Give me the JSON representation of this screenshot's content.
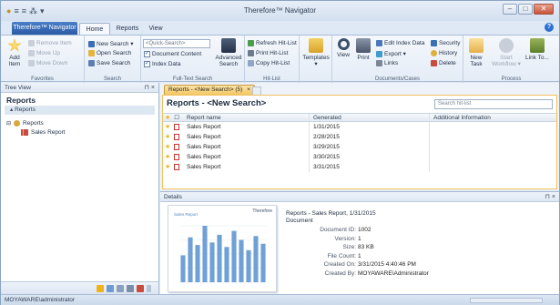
{
  "window": {
    "title": "Therefore™ Navigator",
    "help": "?"
  },
  "qat": [
    "●",
    "≡",
    "≡",
    "⁂",
    "▾"
  ],
  "tabs": {
    "app_menu": "Therefore™ Navigator",
    "home": "Home",
    "reports": "Reports",
    "view": "View"
  },
  "ribbon": {
    "favorites": {
      "add": "Add Item",
      "remove": "Remove Item",
      "move_up": "Move Up",
      "move_down": "Move Down",
      "label": "Favorites"
    },
    "search": {
      "new_search": "New Search ▾",
      "open_search": "Open Search",
      "save_search": "Save Search",
      "label": "Search"
    },
    "fulltext": {
      "placeholder": "<Quick-Search>",
      "document_content": "Document Content",
      "index_data": "Index Data",
      "advanced": "Advanced Search",
      "label": "Full-Text Search"
    },
    "hitlist": {
      "refresh": "Refresh Hit-List",
      "print": "Print Hit-List",
      "copy": "Copy Hit-List",
      "label": "Hit-List"
    },
    "templates": {
      "label": "Templates",
      "arrow": "▾"
    },
    "docs": {
      "view": "View",
      "print": "Print",
      "edit_index": "Edit Index Data",
      "export": "Export ▾",
      "links": "Links",
      "security": "Security",
      "history": "History",
      "delete": "Delete",
      "label": "Documents/Cases"
    },
    "process": {
      "new_task": "New Task",
      "start_workflow": "Start Workflow ▾",
      "link_to": "Link To...",
      "label": "Process"
    }
  },
  "tree_view": {
    "header": "Tree View",
    "controls": "⊓ ×",
    "title": "Reports",
    "sub": "Reports",
    "items": [
      {
        "label": "Reports"
      },
      {
        "label": "Sales Report"
      }
    ]
  },
  "document_tab": {
    "label": "Reports - <New Search> (5)",
    "close": "×"
  },
  "hitlist": {
    "title": "Reports - <New Search>",
    "search_placeholder": "Search hit-list",
    "columns": {
      "name": "Report name",
      "generated": "Generated",
      "additional": "Additional Information"
    },
    "rows": [
      {
        "name": "Sales Report",
        "generated": "1/31/2015"
      },
      {
        "name": "Sales Report",
        "generated": "2/28/2015"
      },
      {
        "name": "Sales Report",
        "generated": "3/29/2015"
      },
      {
        "name": "Sales Report",
        "generated": "3/30/2015"
      },
      {
        "name": "Sales Report",
        "generated": "3/31/2015"
      }
    ]
  },
  "details": {
    "header": "Details",
    "controls": "⊓ ×",
    "thumb_logo": "Therefore",
    "thumb_title": "Sales Report",
    "title": "Reports - Sales Report, 1/31/2015",
    "type": "Document",
    "fields": [
      {
        "key": "Document ID:",
        "value": "1002"
      },
      {
        "key": "Version:",
        "value": "1"
      },
      {
        "key": "Size:",
        "value": "83 KB"
      },
      {
        "key": "File Count:",
        "value": "1"
      },
      {
        "key": "Created On:",
        "value": "3/31/2015 4:40:46 PM"
      },
      {
        "key": "Created By:",
        "value": "MOYAWARE\\Administrator"
      }
    ]
  },
  "status": {
    "user": "MOYAWARE\\administrator"
  },
  "colors": {
    "accent": "#2a5aa6",
    "tab_highlight": "#f3c763",
    "star": "#f0b21a",
    "bars": "#6fa0d6"
  },
  "thumbnail_chart": {
    "values": [
      42,
      70,
      58,
      88,
      62,
      74,
      55,
      80,
      66,
      50,
      72,
      60
    ]
  }
}
